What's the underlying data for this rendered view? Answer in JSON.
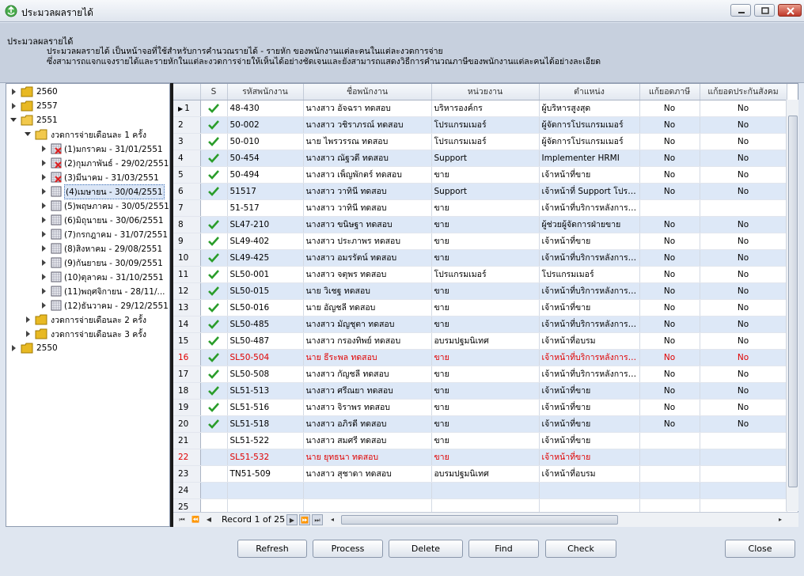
{
  "window": {
    "title": "ประมวลผลรายได้"
  },
  "description": {
    "title": "ประมวลผลรายได้",
    "line1": "ประมวลผลรายได้ เป็นหน้าจอที่ใช้สำหรับการคำนวณรายได้ - รายหัก ของพนักงานแต่ละคนในแต่ละงวดการจ่าย",
    "line2": "ซึ่งสามารถแจกแจงรายได้และรายหักในแต่ละงวดการจ่ายให้เห็นได้อย่างชัดเจนและยังสามารถแสดงวิธีการคำนวณภาษีของพนักงานแต่ละคนได้อย่างละเอียด"
  },
  "tree": {
    "years": [
      "2560",
      "2557",
      "2551",
      "2550"
    ],
    "group1": "งวดการจ่ายเดือนละ 1 ครั้ง",
    "group2": "งวดการจ่ายเดือนละ 2 ครั้ง",
    "group3": "งวดการจ่ายเดือนละ 3 ครั้ง",
    "periods": [
      {
        "label": "(1)มกราคม - 31/01/2551",
        "status": "error"
      },
      {
        "label": "(2)กุมภาพันธ์ - 29/02/2551",
        "status": "error"
      },
      {
        "label": "(3)มีนาคม - 31/03/2551",
        "status": "error"
      },
      {
        "label": "(4)เมษายน - 30/04/2551",
        "status": "normal"
      },
      {
        "label": "(5)พฤษภาคม - 30/05/2551",
        "status": "normal"
      },
      {
        "label": "(6)มิถุนายน - 30/06/2551",
        "status": "normal"
      },
      {
        "label": "(7)กรกฎาคม - 31/07/2551",
        "status": "normal"
      },
      {
        "label": "(8)สิงหาคม - 29/08/2551",
        "status": "normal"
      },
      {
        "label": "(9)กันยายน - 30/09/2551",
        "status": "normal"
      },
      {
        "label": "(10)ตุลาคม - 31/10/2551",
        "status": "normal"
      },
      {
        "label": "(11)พฤศจิกายน - 28/11/...",
        "status": "normal"
      },
      {
        "label": "(12)ธันวาคม - 29/12/2551",
        "status": "normal"
      }
    ]
  },
  "grid": {
    "columns": [
      "S",
      "รหัสพนักงาน",
      "ชื่อพนักงาน",
      "หน่วยงาน",
      "ตำแหน่ง",
      "แก้ยอดภาษี",
      "แก้ยอดประกันสังคม"
    ],
    "rows": [
      {
        "n": "1",
        "checked": true,
        "code": "48-430",
        "name": "นางสาว อัจฉรา ทดสอบ",
        "dept": "บริหารองค์กร",
        "pos": "ผู้บริหารสูงสุด",
        "tax": "No",
        "ss": "No"
      },
      {
        "n": "2",
        "checked": true,
        "code": "50-002",
        "name": "นางสาว วชิราภรณ์ ทดสอบ",
        "dept": "โปรแกรมเมอร์",
        "pos": "ผู้จัดการโปรแกรมเมอร์",
        "tax": "No",
        "ss": "No"
      },
      {
        "n": "3",
        "checked": true,
        "code": "50-010",
        "name": "นาย ไพรวรรณ ทดสอบ",
        "dept": "โปรแกรมเมอร์",
        "pos": "ผู้จัดการโปรแกรมเมอร์",
        "tax": "No",
        "ss": "No"
      },
      {
        "n": "4",
        "checked": true,
        "code": "50-454",
        "name": "นางสาว ณัฐวดี ทดสอบ",
        "dept": "Support",
        "pos": "Implementer HRMI",
        "tax": "No",
        "ss": "No"
      },
      {
        "n": "5",
        "checked": true,
        "code": "50-494",
        "name": "นางสาว เพ็ญพักตร์ ทดสอบ",
        "dept": "ขาย",
        "pos": "เจ้าหน้าที่ขาย",
        "tax": "No",
        "ss": "No"
      },
      {
        "n": "6",
        "checked": true,
        "code": "51517",
        "name": "นางสาว วาทินี ทดสอบ",
        "dept": "Support",
        "pos": "เจ้าหน้าที่ Support โปรแกรม",
        "tax": "No",
        "ss": "No"
      },
      {
        "n": "7",
        "checked": false,
        "code": "51-517",
        "name": "นางสาว วาทินี ทดสอบ",
        "dept": "ขาย",
        "pos": "เจ้าหน้าที่บริการหลังการขาย",
        "tax": "",
        "ss": ""
      },
      {
        "n": "8",
        "checked": true,
        "code": "SL47-210",
        "name": "นางสาว ขนิษฐา ทดสอบ",
        "dept": "ขาย",
        "pos": "ผู้ช่วยผู้จัดการฝ่ายขาย",
        "tax": "No",
        "ss": "No"
      },
      {
        "n": "9",
        "checked": true,
        "code": "SL49-402",
        "name": "นางสาว ประภาพร ทดสอบ",
        "dept": "ขาย",
        "pos": "เจ้าหน้าที่ขาย",
        "tax": "No",
        "ss": "No"
      },
      {
        "n": "10",
        "checked": true,
        "code": "SL49-425",
        "name": "นางสาว อมรรัตน์ ทดสอบ",
        "dept": "ขาย",
        "pos": "เจ้าหน้าที่บริการหลังการขาย",
        "tax": "No",
        "ss": "No"
      },
      {
        "n": "11",
        "checked": true,
        "code": "SL50-001",
        "name": "นางสาว จตุพร ทดสอบ",
        "dept": "โปรแกรมเมอร์",
        "pos": "โปรแกรมเมอร์",
        "tax": "No",
        "ss": "No"
      },
      {
        "n": "12",
        "checked": true,
        "code": "SL50-015",
        "name": "นาย วิเชฐ ทดสอบ",
        "dept": "ขาย",
        "pos": "เจ้าหน้าที่บริการหลังการขาย",
        "tax": "No",
        "ss": "No"
      },
      {
        "n": "13",
        "checked": true,
        "code": "SL50-016",
        "name": "นาย อัญชลี ทดสอบ",
        "dept": "ขาย",
        "pos": "เจ้าหน้าที่ขาย",
        "tax": "No",
        "ss": "No"
      },
      {
        "n": "14",
        "checked": true,
        "code": "SL50-485",
        "name": "นางสาว มัญชุตา ทดสอบ",
        "dept": "ขาย",
        "pos": "เจ้าหน้าที่บริการหลังการขาย",
        "tax": "No",
        "ss": "No"
      },
      {
        "n": "15",
        "checked": true,
        "code": "SL50-487",
        "name": "นางสาว กรองทิพย์ ทดสอบ",
        "dept": "อบรมปฐมนิเทศ",
        "pos": "เจ้าหน้าที่อบรม",
        "tax": "No",
        "ss": "No"
      },
      {
        "n": "16",
        "checked": true,
        "red": true,
        "code": "SL50-504",
        "name": "นาย ธีระพล ทดสอบ",
        "dept": "ขาย",
        "pos": "เจ้าหน้าที่บริการหลังการขาย",
        "tax": "No",
        "ss": "No"
      },
      {
        "n": "17",
        "checked": true,
        "code": "SL50-508",
        "name": "นางสาว กัญชลี ทดสอบ",
        "dept": "ขาย",
        "pos": "เจ้าหน้าที่บริการหลังการขาย",
        "tax": "No",
        "ss": "No"
      },
      {
        "n": "18",
        "checked": true,
        "code": "SL51-513",
        "name": "นางสาว ศรีณยา ทดสอบ",
        "dept": "ขาย",
        "pos": "เจ้าหน้าที่ขาย",
        "tax": "No",
        "ss": "No"
      },
      {
        "n": "19",
        "checked": true,
        "code": "SL51-516",
        "name": "นางสาว จิราพร ทดสอบ",
        "dept": "ขาย",
        "pos": "เจ้าหน้าที่ขาย",
        "tax": "No",
        "ss": "No"
      },
      {
        "n": "20",
        "checked": true,
        "code": "SL51-518",
        "name": "นางสาว อภิรดี ทดสอบ",
        "dept": "ขาย",
        "pos": "เจ้าหน้าที่ขาย",
        "tax": "No",
        "ss": "No"
      },
      {
        "n": "21",
        "checked": false,
        "code": "SL51-522",
        "name": "นางสาว สมศรี ทดสอบ",
        "dept": "ขาย",
        "pos": "เจ้าหน้าที่ขาย",
        "tax": "",
        "ss": ""
      },
      {
        "n": "22",
        "checked": false,
        "red": true,
        "code": "SL51-532",
        "name": "นาย ยุทธนา ทดสอบ",
        "dept": "ขาย",
        "pos": "เจ้าหน้าที่ขาย",
        "tax": "",
        "ss": ""
      },
      {
        "n": "23",
        "checked": false,
        "code": "TN51-509",
        "name": "นางสาว สุชาดา ทดสอบ",
        "dept": "อบรมปฐมนิเทศ",
        "pos": "เจ้าหน้าที่อบรม",
        "tax": "",
        "ss": ""
      },
      {
        "n": "24",
        "checked": false,
        "code": "",
        "name": "",
        "dept": "",
        "pos": "",
        "tax": "",
        "ss": ""
      },
      {
        "n": "25",
        "checked": false,
        "code": "",
        "name": "",
        "dept": "",
        "pos": "",
        "tax": "",
        "ss": ""
      }
    ],
    "record_text": "Record 1 of 25"
  },
  "buttons": {
    "refresh": "Refresh",
    "process": "Process",
    "delete": "Delete",
    "find": "Find",
    "check": "Check",
    "close": "Close"
  },
  "colors": {
    "alt_row": "#dde8f7",
    "error_text": "#e00000",
    "check_green": "#2a9d2a"
  }
}
